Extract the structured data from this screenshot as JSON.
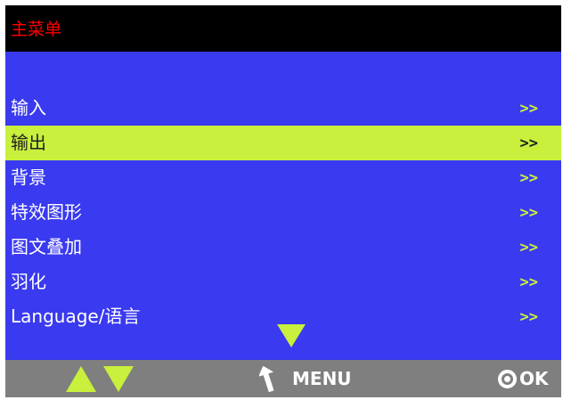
{
  "title": "主菜单",
  "menu": {
    "items": [
      {
        "label": "输入",
        "arrow": ">>"
      },
      {
        "label": "输出",
        "arrow": ">>"
      },
      {
        "label": "背景",
        "arrow": ">>"
      },
      {
        "label": "特效图形",
        "arrow": ">>"
      },
      {
        "label": "图文叠加",
        "arrow": ">>"
      },
      {
        "label": "羽化",
        "arrow": ">>"
      },
      {
        "label": "Language/语言",
        "arrow": ">>"
      }
    ],
    "selected_index": 1
  },
  "scroll_indicator": {
    "icon": "down-triangle-icon",
    "has_more": true
  },
  "footer": {
    "nav_icons": [
      "up-triangle-icon",
      "down-triangle-icon"
    ],
    "menu_label": "MENU",
    "ok_label": "OK"
  },
  "colors": {
    "title_bar": "#000000",
    "title_text": "#ff0000",
    "menu_background": "#3a3af0",
    "highlight": "#c8f03c",
    "footer_background": "#7f7f7f"
  }
}
